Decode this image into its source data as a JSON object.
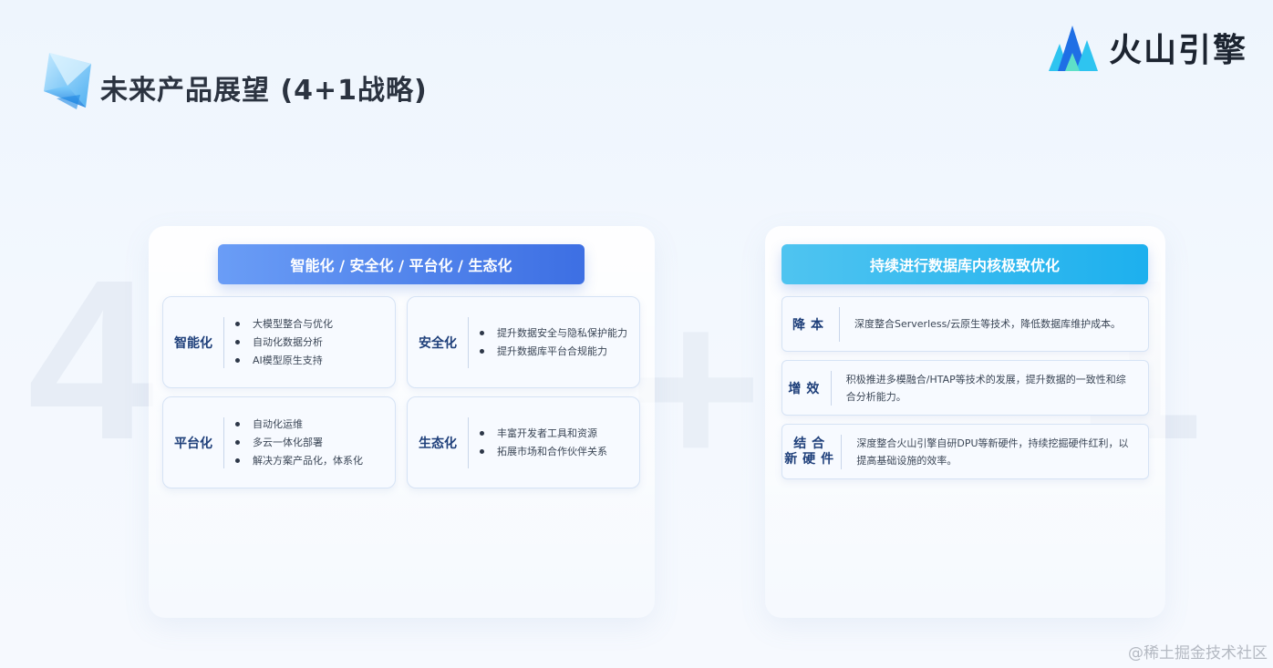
{
  "page_title": "未来产品展望 (4+1战略)",
  "logo": {
    "text": "火山引擎",
    "icon": "volcano-engine-logo-icon"
  },
  "background_glyphs": {
    "four": "4",
    "plus": "+",
    "one": "1"
  },
  "left_panel": {
    "banner": "智能化 / 安全化 / 平台化 / 生态化",
    "cards": [
      {
        "title": "智能化",
        "items": [
          "大模型整合与优化",
          "自动化数据分析",
          "AI模型原生支持"
        ]
      },
      {
        "title": "安全化",
        "items": [
          "提升数据安全与隐私保护能力",
          "提升数据库平台合规能力"
        ]
      },
      {
        "title": "平台化",
        "items": [
          "自动化运维",
          "多云一体化部署",
          "解决方案产品化，体系化"
        ]
      },
      {
        "title": "生态化",
        "items": [
          "丰富开发者工具和资源",
          "拓展市场和合作伙伴关系"
        ]
      }
    ]
  },
  "right_panel": {
    "banner": "持续进行数据库内核极致优化",
    "rows": [
      {
        "title_lines": [
          "降本"
        ],
        "text": "深度整合Serverless/云原生等技术，降低数据库维护成本。"
      },
      {
        "title_lines": [
          "增效"
        ],
        "text": "积极推进多模融合/HTAP等技术的发展，提升数据的一致性和综合分析能力。"
      },
      {
        "title_lines": [
          "结合",
          "新硬件"
        ],
        "text": "深度整合火山引擎自研DPU等新硬件，持续挖掘硬件红利，以提高基础设施的效率。"
      }
    ]
  },
  "watermark": "@稀土掘金技术社区"
}
